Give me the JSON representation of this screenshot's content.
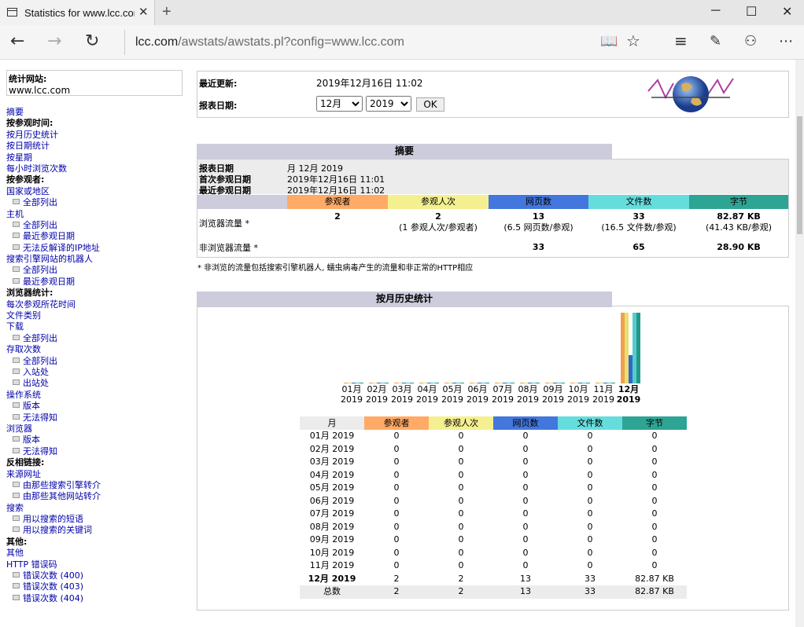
{
  "browser": {
    "tab_title": "Statistics for www.lcc.com",
    "url_host": "lcc.com",
    "url_path": "/awstats/awstats.pl?config=www.lcc.com"
  },
  "sidebar": {
    "site_label": "统计网站:",
    "site_value": "www.lcc.com",
    "menu": [
      {
        "text": "摘要",
        "type": "link"
      },
      {
        "text": "按参观时间:",
        "type": "head"
      },
      {
        "text": "按月历史统计",
        "type": "link"
      },
      {
        "text": "按日期统计",
        "type": "link"
      },
      {
        "text": "按星期",
        "type": "link"
      },
      {
        "text": "每小时浏览次数",
        "type": "link"
      },
      {
        "text": "按参观者:",
        "type": "head"
      },
      {
        "text": "国家或地区",
        "type": "link"
      },
      {
        "text": "全部列出",
        "type": "sub"
      },
      {
        "text": "主机",
        "type": "link"
      },
      {
        "text": "全部列出",
        "type": "sub"
      },
      {
        "text": "最近参观日期",
        "type": "sub"
      },
      {
        "text": "无法反解译的IP地址",
        "type": "sub"
      },
      {
        "text": "搜索引擎网站的机器人",
        "type": "link"
      },
      {
        "text": "全部列出",
        "type": "sub"
      },
      {
        "text": "最近参观日期",
        "type": "sub"
      },
      {
        "text": "浏览器统计:",
        "type": "head"
      },
      {
        "text": "每次参观所花时间",
        "type": "link"
      },
      {
        "text": "文件类别",
        "type": "link"
      },
      {
        "text": "下载",
        "type": "link"
      },
      {
        "text": "全部列出",
        "type": "sub"
      },
      {
        "text": "存取次数",
        "type": "link"
      },
      {
        "text": "全部列出",
        "type": "sub"
      },
      {
        "text": "入站处",
        "type": "sub"
      },
      {
        "text": "出站处",
        "type": "sub"
      },
      {
        "text": "操作系统",
        "type": "link"
      },
      {
        "text": "版本",
        "type": "sub"
      },
      {
        "text": "无法得知",
        "type": "sub"
      },
      {
        "text": "浏览器",
        "type": "link"
      },
      {
        "text": "版本",
        "type": "sub"
      },
      {
        "text": "无法得知",
        "type": "sub"
      },
      {
        "text": "反相链接:",
        "type": "head"
      },
      {
        "text": "来源网址",
        "type": "link"
      },
      {
        "text": "由那些搜索引擎转介",
        "type": "sub"
      },
      {
        "text": "由那些其他网站转介",
        "type": "sub"
      },
      {
        "text": "搜索",
        "type": "link"
      },
      {
        "text": "用以搜索的短语",
        "type": "sub"
      },
      {
        "text": "用以搜索的关键词",
        "type": "sub"
      },
      {
        "text": "其他:",
        "type": "head"
      },
      {
        "text": "其他",
        "type": "link"
      },
      {
        "text": "HTTP 错误码",
        "type": "link"
      },
      {
        "text": "错误次数 (400)",
        "type": "sub"
      },
      {
        "text": "错误次数 (403)",
        "type": "sub"
      },
      {
        "text": "错误次数 (404)",
        "type": "sub"
      }
    ]
  },
  "update": {
    "last_update_label": "最近更新:",
    "last_update_value": "2019年12月16日 11:02",
    "report_date_label": "报表日期:",
    "month_selected": "12月",
    "year_selected": "2019",
    "ok_label": "OK"
  },
  "summary": {
    "title": "摘要",
    "period_label": "报表日期",
    "period_value": "月 12月 2019",
    "first_visit_label": "首次参观日期",
    "first_visit_value": "2019年12月16日 11:01",
    "last_visit_label": "最近参观日期",
    "last_visit_value": "2019年12月16日 11:02",
    "headers": [
      "参观者",
      "参观人次",
      "网页数",
      "文件数",
      "字节"
    ],
    "header_colors": [
      "#ffaa66",
      "#f4f090",
      "#4477dd",
      "#66dddd",
      "#2ea495"
    ],
    "viewed_label": "浏览器流量 *",
    "viewed": [
      "2",
      "2",
      "13",
      "33",
      "82.87 KB"
    ],
    "viewed_sub": [
      "",
      "(1 参观人次/参观者)",
      "(6.5 网页数/参观)",
      "(16.5 文件数/参观)",
      "(41.43 KB/参观)"
    ],
    "notviewed_label": "非浏览器流量 *",
    "notviewed": [
      "",
      "",
      "33",
      "65",
      "28.90 KB"
    ],
    "footnote": "* 非浏览的流量包括搜索引擎机器人, 蠕虫病毒产生的流量和非正常的HTTP相应"
  },
  "monthly": {
    "title": "按月历史统计",
    "headers": [
      "月",
      "参观者",
      "参观人次",
      "网页数",
      "文件数",
      "字节"
    ],
    "rows": [
      [
        "01月 2019",
        "0",
        "0",
        "0",
        "0",
        "0"
      ],
      [
        "02月 2019",
        "0",
        "0",
        "0",
        "0",
        "0"
      ],
      [
        "03月 2019",
        "0",
        "0",
        "0",
        "0",
        "0"
      ],
      [
        "04月 2019",
        "0",
        "0",
        "0",
        "0",
        "0"
      ],
      [
        "05月 2019",
        "0",
        "0",
        "0",
        "0",
        "0"
      ],
      [
        "06月 2019",
        "0",
        "0",
        "0",
        "0",
        "0"
      ],
      [
        "07月 2019",
        "0",
        "0",
        "0",
        "0",
        "0"
      ],
      [
        "08月 2019",
        "0",
        "0",
        "0",
        "0",
        "0"
      ],
      [
        "09月 2019",
        "0",
        "0",
        "0",
        "0",
        "0"
      ],
      [
        "10月 2019",
        "0",
        "0",
        "0",
        "0",
        "0"
      ],
      [
        "11月 2019",
        "0",
        "0",
        "0",
        "0",
        "0"
      ],
      [
        "12月 2019",
        "2",
        "2",
        "13",
        "33",
        "82.87 KB"
      ]
    ],
    "total": [
      "总数",
      "2",
      "2",
      "13",
      "33",
      "82.87 KB"
    ]
  },
  "chart_data": {
    "type": "bar",
    "categories": [
      "01月 2019",
      "02月 2019",
      "03月 2019",
      "04月 2019",
      "05月 2019",
      "06月 2019",
      "07月 2019",
      "08月 2019",
      "09月 2019",
      "10月 2019",
      "11月 2019",
      "12月 2019"
    ],
    "tick_month": [
      "01月",
      "02月",
      "03月",
      "04月",
      "05月",
      "06月",
      "07月",
      "08月",
      "09月",
      "10月",
      "11月",
      "12月"
    ],
    "tick_year": [
      "2019",
      "2019",
      "2019",
      "2019",
      "2019",
      "2019",
      "2019",
      "2019",
      "2019",
      "2019",
      "2019",
      "2019"
    ],
    "series": [
      {
        "name": "参观者",
        "values": [
          0,
          0,
          0,
          0,
          0,
          0,
          0,
          0,
          0,
          0,
          0,
          2
        ],
        "color": "#f0a050"
      },
      {
        "name": "参观人次",
        "values": [
          0,
          0,
          0,
          0,
          0,
          0,
          0,
          0,
          0,
          0,
          0,
          2
        ],
        "color": "#e8e070"
      },
      {
        "name": "网页数",
        "values": [
          0,
          0,
          0,
          0,
          0,
          0,
          0,
          0,
          0,
          0,
          0,
          13
        ],
        "color": "#3366cc"
      },
      {
        "name": "文件数",
        "values": [
          0,
          0,
          0,
          0,
          0,
          0,
          0,
          0,
          0,
          0,
          0,
          33
        ],
        "color": "#55cccc"
      },
      {
        "name": "字节",
        "values": [
          0,
          0,
          0,
          0,
          0,
          0,
          0,
          0,
          0,
          0,
          0,
          82.87
        ],
        "color": "#229988"
      }
    ],
    "highlight_category": "12月 2019"
  }
}
